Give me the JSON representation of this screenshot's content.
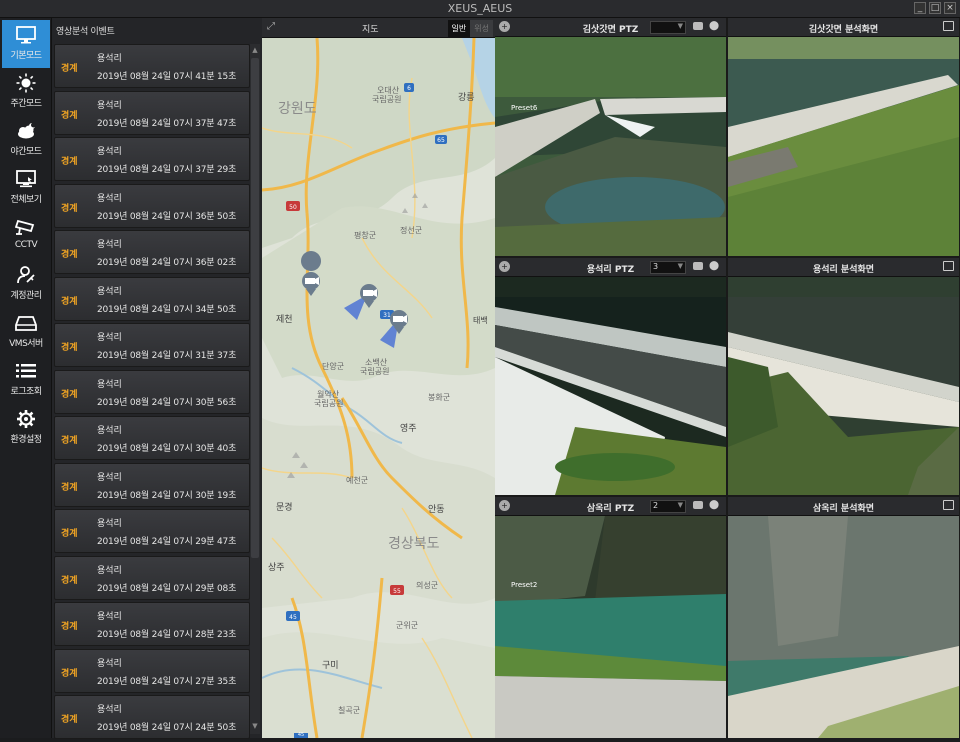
{
  "app": {
    "title": "XEUS_AEUS"
  },
  "nav": {
    "items": [
      {
        "label": "기본모드",
        "icon": "monitor-icon"
      },
      {
        "label": "주간모드",
        "icon": "sun-icon"
      },
      {
        "label": "야간모드",
        "icon": "cloud-moon-icon"
      },
      {
        "label": "전체보기",
        "icon": "display-icon"
      },
      {
        "label": "CCTV",
        "icon": "cctv-camera-icon"
      },
      {
        "label": "계정관리",
        "icon": "user-key-icon"
      },
      {
        "label": "VMS서버",
        "icon": "server-drive-icon"
      },
      {
        "label": "로그조회",
        "icon": "list-icon"
      },
      {
        "label": "환경설정",
        "icon": "gear-icon"
      }
    ]
  },
  "events": {
    "header": "영상분석 이벤트",
    "items": [
      {
        "badge": "경계",
        "place": "용석리",
        "time": "2019년 08월 24일 07시 41분 15초"
      },
      {
        "badge": "경계",
        "place": "용석리",
        "time": "2019년 08월 24일 07시 37분 47초"
      },
      {
        "badge": "경계",
        "place": "용석리",
        "time": "2019년 08월 24일 07시 37분 29초"
      },
      {
        "badge": "경계",
        "place": "용석리",
        "time": "2019년 08월 24일 07시 36분 50초"
      },
      {
        "badge": "경계",
        "place": "용석리",
        "time": "2019년 08월 24일 07시 36분 02초"
      },
      {
        "badge": "경계",
        "place": "용석리",
        "time": "2019년 08월 24일 07시 34분 50초"
      },
      {
        "badge": "경계",
        "place": "용석리",
        "time": "2019년 08월 24일 07시 31분 37초"
      },
      {
        "badge": "경계",
        "place": "용석리",
        "time": "2019년 08월 24일 07시 30분 56초"
      },
      {
        "badge": "경계",
        "place": "용석리",
        "time": "2019년 08월 24일 07시 30분 40초"
      },
      {
        "badge": "경계",
        "place": "용석리",
        "time": "2019년 08월 24일 07시 30분 19초"
      },
      {
        "badge": "경계",
        "place": "용석리",
        "time": "2019년 08월 24일 07시 29분 47초"
      },
      {
        "badge": "경계",
        "place": "용석리",
        "time": "2019년 08월 24일 07시 29분 08초"
      },
      {
        "badge": "경계",
        "place": "용석리",
        "time": "2019년 08월 24일 07시 28분 23초"
      },
      {
        "badge": "경계",
        "place": "용석리",
        "time": "2019년 08월 24일 07시 27분 35초"
      },
      {
        "badge": "경계",
        "place": "용석리",
        "time": "2019년 08월 24일 07시 24분 50초"
      }
    ]
  },
  "map": {
    "title": "지도",
    "tabs": [
      "일반",
      "위성"
    ],
    "labels": {
      "gangwon": "강원도",
      "odaesan": "오대산",
      "odaesan_park": "국립공원",
      "gangneung": "강릉",
      "pyeongchang": "평창군",
      "jeongseon": "정선군",
      "jecheon": "제천",
      "taebaek": "태백",
      "danyang": "단양군",
      "sobaeksan": "소백산",
      "sobaeksan_park": "국립공원",
      "worak": "월악산",
      "worak_park": "국립공원",
      "bonghwa": "봉화군",
      "yeongju": "영주",
      "yecheon": "예천군",
      "mungyeong": "문경",
      "andong": "안동",
      "gyeongbuk": "경상북도",
      "sangju": "상주",
      "uiseong": "의성군",
      "gunwi": "군위군",
      "gumi": "구미",
      "chilgok": "칠곡군"
    },
    "road_numbers": {
      "r6": "6",
      "r65a": "65",
      "r50": "50",
      "r31": "31",
      "r55": "55",
      "r45a": "45",
      "r45b": "45"
    }
  },
  "cameras": [
    {
      "title": "김삿갓면 PTZ",
      "preset": "",
      "osd": "Preset6"
    },
    {
      "title": "김삿갓면 분석화면"
    },
    {
      "title": "용석리 PTZ",
      "preset": "3"
    },
    {
      "title": "용석리 분석화면"
    },
    {
      "title": "삼옥리 PTZ",
      "preset": "2",
      "osd": "Preset2"
    },
    {
      "title": "삼옥리 분석화면"
    }
  ],
  "colors": {
    "accent": "#2f8ed6",
    "alert": "#f3a623"
  }
}
